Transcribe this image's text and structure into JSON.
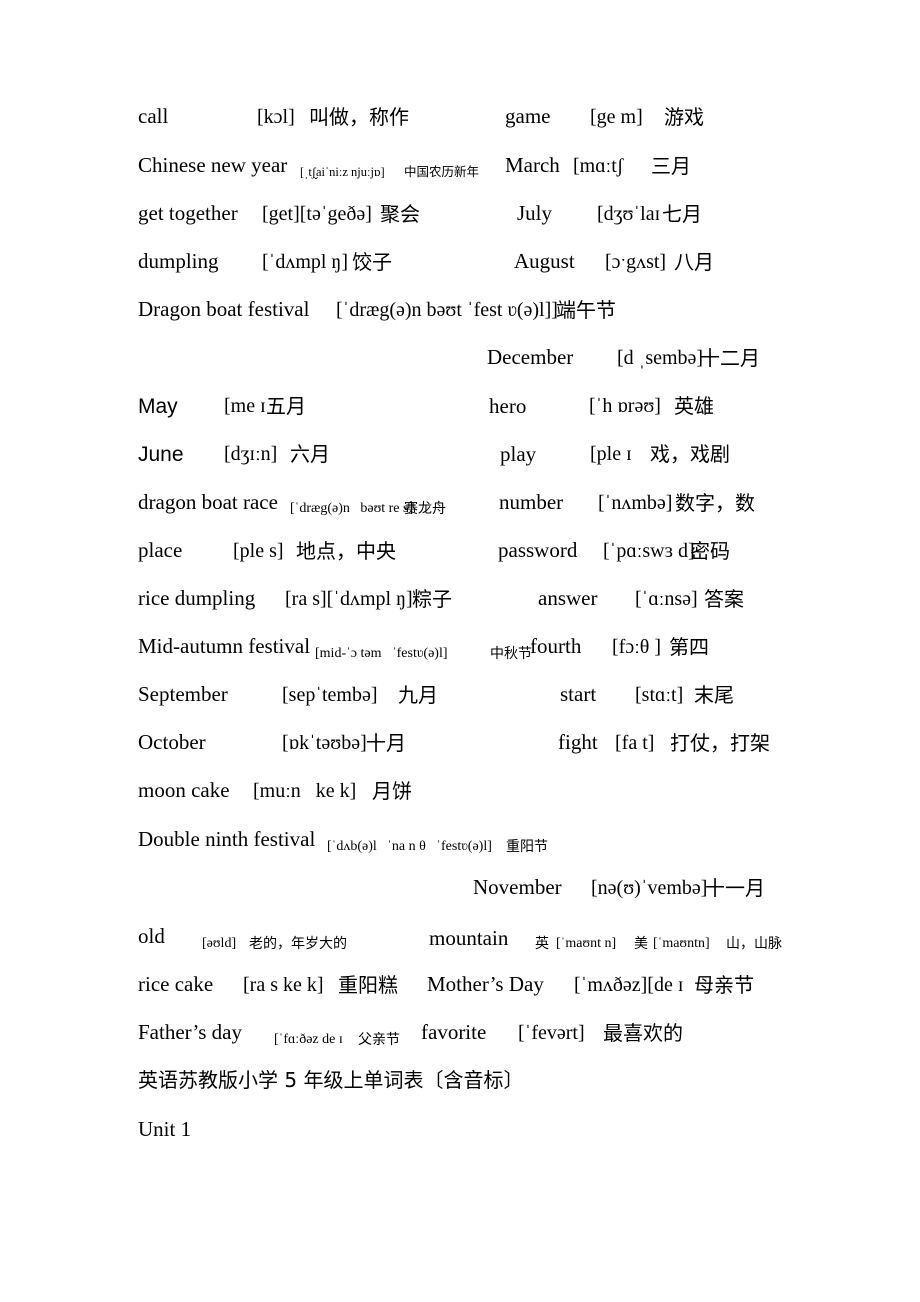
{
  "document": {
    "title_line": "英语苏教版小学 5 年级上单词表〔含音标〕",
    "unit_label": "Unit 1"
  },
  "entries": {
    "call": {
      "word": "call",
      "ipa": "[kɔl]",
      "cn": "叫做，称作"
    },
    "game": {
      "word": "game",
      "ipa": "[ge m]",
      "cn": "游戏"
    },
    "chinese_new_year": {
      "word": "Chinese new year",
      "ipa": "[ˌtʃ̬aiˈniːz njuːjɒ]",
      "cn": "中国农历新年"
    },
    "march": {
      "word": "March",
      "ipa": "[mɑːtʃ",
      "cn": "三月"
    },
    "get_together": {
      "word": "get together",
      "ipa": "[get][təˈgeðə]",
      "cn": "聚会"
    },
    "july": {
      "word": "July",
      "ipa": "[dʒʊˈlaɪ",
      "cn": "七月"
    },
    "dumpling": {
      "word": "dumpling",
      "ipa": "[ˈdʌmpl ŋ]",
      "cn": "饺子"
    },
    "august": {
      "word": "August",
      "ipa": "[ɔˑgʌst]",
      "cn": "八月"
    },
    "dragon_boat_festival": {
      "word": "Dragon boat festival",
      "ipa": "[ˈdræg(ə)n bəʊt ˈfest ʋ(ə)l]]",
      "cn": "端午节"
    },
    "december": {
      "word": "December",
      "ipa": "[d ˌsembə]",
      "cn": "十二月"
    },
    "may": {
      "word": "May",
      "ipa": "[me ɪ",
      "cn": "五月"
    },
    "hero": {
      "word": "hero",
      "ipa": "[ˈh ɒrəʊ]",
      "cn": "英雄"
    },
    "june": {
      "word": "June",
      "ipa": "[dʒɪːn]",
      "cn": "六月"
    },
    "play": {
      "word": "play",
      "ipa": "[ple ɪ",
      "cn": "戏，戏剧"
    },
    "dragon_boat_race": {
      "word": "dragon boat race",
      "ipa": "[ˈdræg(ə)n   bəʊt re s]",
      "cn": "赛龙舟"
    },
    "number": {
      "word": "number",
      "ipa": "[ˈnʌmbə]",
      "cn": "数字，数"
    },
    "place": {
      "word": "place",
      "ipa": "[ple s]",
      "cn": "地点，中央"
    },
    "password": {
      "word": "password",
      "ipa": "[ˈpɑːswɜ d]",
      "cn": "密码"
    },
    "rice_dumpling": {
      "word": "rice dumpling",
      "ipa": "[ra s][ˈdʌmpl ŋ]",
      "cn": "粽子"
    },
    "answer": {
      "word": "answer",
      "ipa": "[ˈɑːnsə]",
      "cn": "答案"
    },
    "mid_autumn_festival": {
      "word": "Mid-autumn festival",
      "ipa": "[mid-ˈɔ təm   ˈfestʋ(ə)l]",
      "cn": "中秋节"
    },
    "fourth": {
      "word": "fourth",
      "ipa": "[fɔːθ ]",
      "cn": "第四"
    },
    "september": {
      "word": "September",
      "ipa": "[sepˈtembə]",
      "cn": "九月"
    },
    "start": {
      "word": "start",
      "ipa": "[stɑːt]",
      "cn": "末尾"
    },
    "october": {
      "word": "October",
      "ipa": "[ɒkˈtəʊbə]",
      "cn": "十月"
    },
    "fight": {
      "word": "fight",
      "ipa": "[fa t]",
      "cn": "打仗，打架"
    },
    "moon_cake": {
      "word": "moon cake",
      "ipa": "[muːn   ke k]",
      "cn": "月饼"
    },
    "double_ninth_festival": {
      "word": "Double ninth festival",
      "ipa": "[ˈdʌb(ə)l   ˈna n θ   ˈfestʋ(ə)l]",
      "cn": "重阳节"
    },
    "november": {
      "word": "November",
      "ipa": "[nə(ʊ)ˈvembə]",
      "cn": "十一月"
    },
    "old": {
      "word": "old",
      "ipa": "[əʊld]",
      "cn": "老的，年岁大的"
    },
    "mountain": {
      "word": "mountain",
      "ipa_uk_label": "英",
      "ipa_uk": "[ˈmaʊnt n]",
      "ipa_us_label": "美",
      "ipa_us": "[ˈmaʊntn]",
      "cn": "山，山脉"
    },
    "rice_cake": {
      "word": "rice cake",
      "ipa": "[ra s ke k]",
      "cn": "重阳糕"
    },
    "mothers_day": {
      "word": "Mother’s Day",
      "ipa": "[ˈmʌðəz][de ɪ",
      "cn": "母亲节"
    },
    "fathers_day": {
      "word": "Father’s day",
      "ipa": "[ˈfɑːðəz de ɪ",
      "cn": "父亲节"
    },
    "favorite": {
      "word": "favorite",
      "ipa": "[ˈfevərt]",
      "cn": "最喜欢的"
    }
  }
}
